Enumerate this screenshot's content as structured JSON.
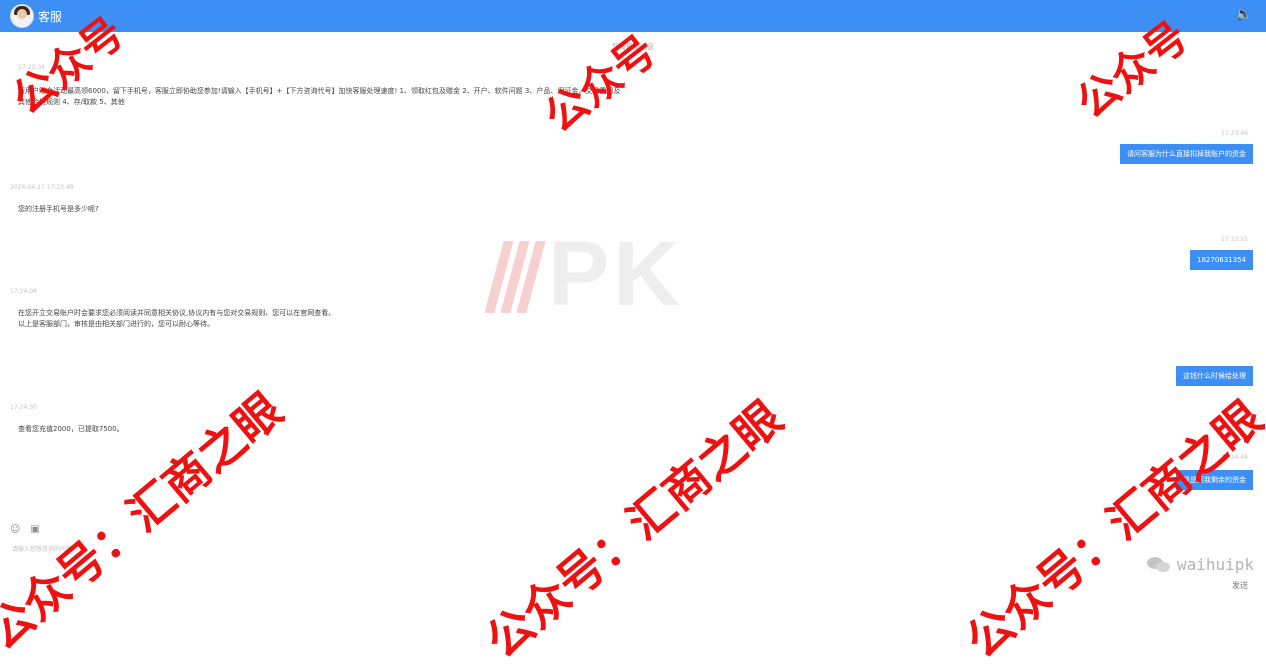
{
  "header": {
    "agent_name": "客服",
    "speaker_icon": "speaker-icon",
    "color": "#3d8ff5"
  },
  "chat": {
    "hint": "您有最新消息",
    "messages": [
      {
        "dir": "in",
        "time": "17:23:34",
        "text_lines": [
          "新用户赠金活动最高领6000，留下手机号，客服立即协助您参加!请输入【手机号】+【下方咨询代号】加快客服处理速度! 1、领取红包及赠金 2、开户、软件问题 3、产品、保证金、交易费用及",
          "其他合约规则 4、存/取款 5、其他"
        ]
      },
      {
        "dir": "out",
        "time": "17:23:46",
        "text": "请问客服为什么直接扣掉我账户的资金"
      },
      {
        "dir": "in",
        "time": "2024-04-17 17:23:49",
        "text_lines": [
          "您的注册手机号是多少呢?"
        ]
      },
      {
        "dir": "out",
        "time": "17:23:55",
        "text": "18270631354"
      },
      {
        "dir": "in",
        "time": "17:24:08",
        "text_lines": [
          "在您开立交易账户时会要求您必须阅读并同意相关协议,协议内有与您对交易规则、您可以在官网查看。",
          "以上是客服部门，审核是由相关部门进行的，您可以耐心等待。"
        ]
      },
      {
        "dir": "out",
        "time": "",
        "text": "这钱什么时候给处理"
      },
      {
        "dir": "in",
        "time": "17:24:30",
        "text_lines": [
          "查看您充值2000，已提取7500。"
        ]
      },
      {
        "dir": "out",
        "time": "17:24:44",
        "text": "我是问我剩余的资金"
      }
    ]
  },
  "input": {
    "emoji_icon": "emoji-icon",
    "image_icon": "image-icon",
    "placeholder": "请输入您想咨询的问题",
    "send_label": "发送"
  },
  "watermarks": {
    "pk_logo": "PK",
    "site_badge": "waihuipk",
    "top_text": "公众号",
    "bottom_text": "公众号：汇商之眼",
    "color": "#ee1111"
  }
}
